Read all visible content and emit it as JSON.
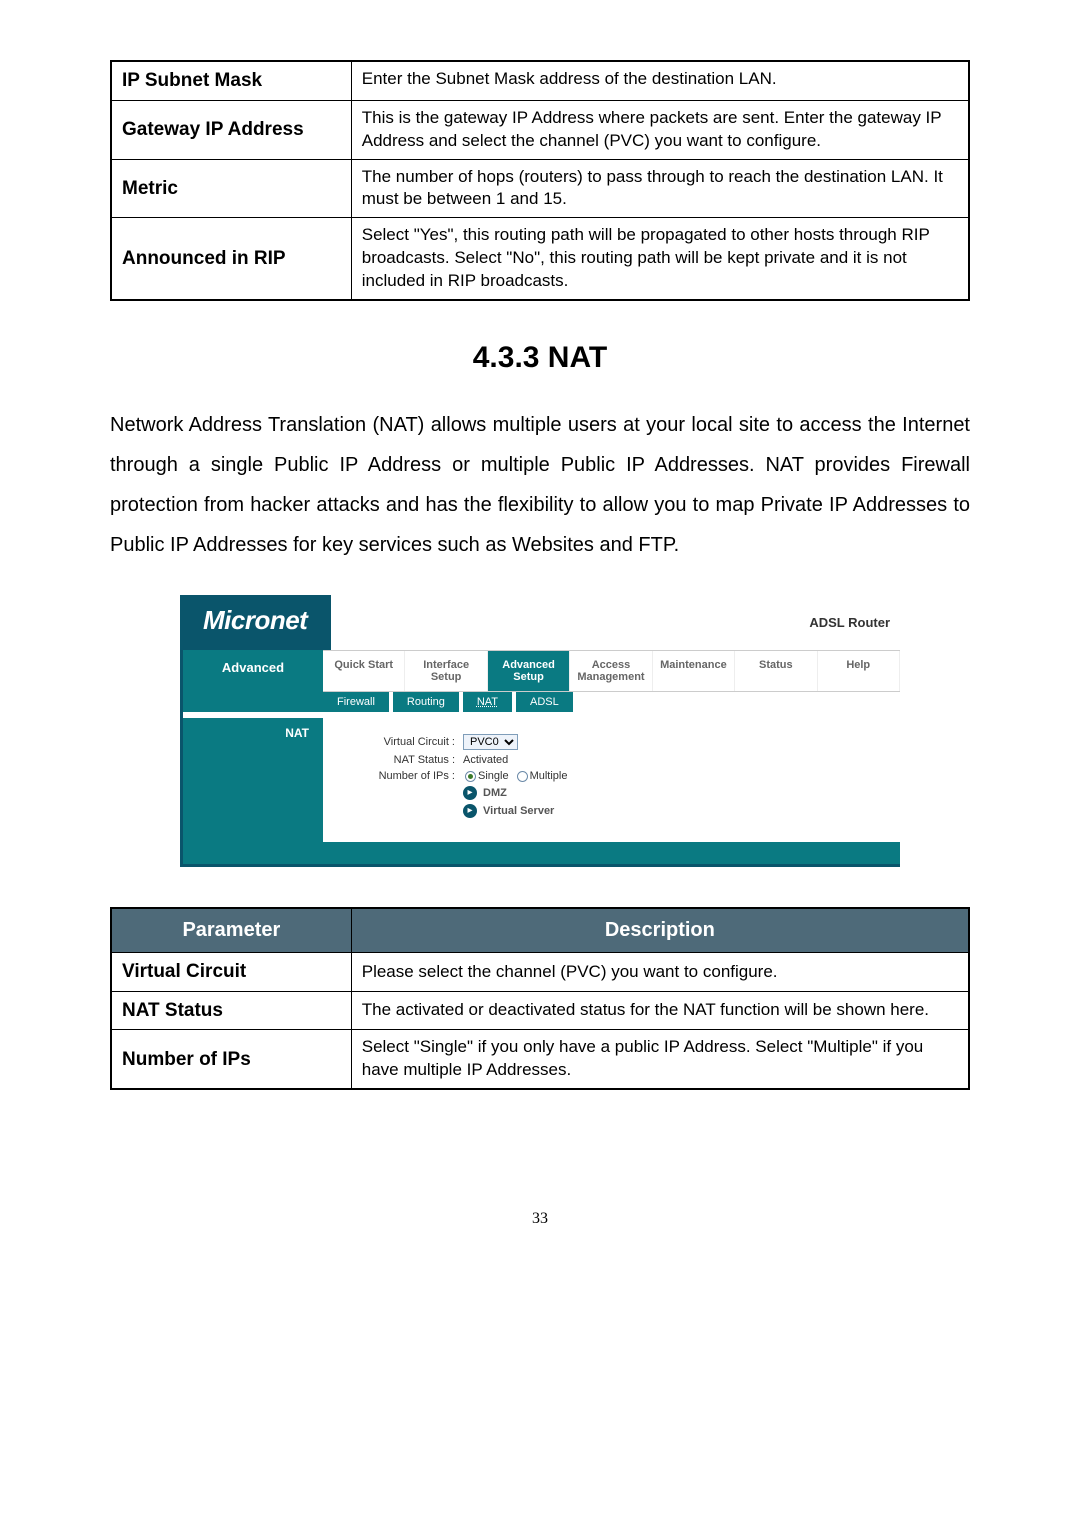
{
  "table1": {
    "rows": [
      {
        "label": "IP Subnet Mask",
        "desc": "Enter the Subnet Mask address of the destination LAN."
      },
      {
        "label": "Gateway IP Address",
        "desc": "This is the gateway IP Address where packets are sent. Enter the gateway IP Address and select the channel (PVC) you want to configure."
      },
      {
        "label": "Metric",
        "desc": "The number of hops (routers) to pass through to reach the destination LAN. It must be between 1 and 15."
      },
      {
        "label": "Announced in RIP",
        "desc": "Select \"Yes\", this routing path will be propagated to other hosts through RIP broadcasts. Select \"No\", this routing path will be kept private and it is not included in RIP broadcasts."
      }
    ]
  },
  "section_heading": "4.3.3  NAT",
  "paragraph": "Network Address Translation (NAT) allows multiple users at your local site to access the Internet through a single Public IP Address or multiple Public IP Addresses. NAT provides Firewall protection from hacker attacks and has the flexibility to allow you to map Private IP Addresses to Public IP Addresses for key services such as Websites and FTP.",
  "shot": {
    "logo": "Micronet",
    "router": "ADSL Router",
    "side_label": "Advanced",
    "top_menu": [
      "Quick Start",
      "Interface Setup",
      "Advanced Setup",
      "Access Management",
      "Maintenance",
      "Status",
      "Help"
    ],
    "tabs": [
      "Firewall",
      "Routing",
      "NAT",
      "ADSL"
    ],
    "nat_label": "NAT",
    "form": {
      "vc_label": "Virtual Circuit :",
      "vc_value": "PVC0",
      "status_label": "NAT Status :",
      "status_value": "Activated",
      "num_label": "Number of IPs :",
      "num_opt1": "Single",
      "num_opt2": "Multiple",
      "link1": "DMZ",
      "link2": "Virtual Server"
    }
  },
  "table2": {
    "head_param": "Parameter",
    "head_desc": "Description",
    "rows": [
      {
        "label": "Virtual Circuit",
        "desc": "Please select the channel (PVC) you want to configure."
      },
      {
        "label": "NAT Status",
        "desc": "The activated or deactivated status for the NAT function will be shown here."
      },
      {
        "label": "Number of IPs",
        "desc": "Select \"Single\" if you only have a public IP Address. Select \"Multiple\" if you have multiple IP Addresses."
      }
    ]
  },
  "page_number": "33"
}
